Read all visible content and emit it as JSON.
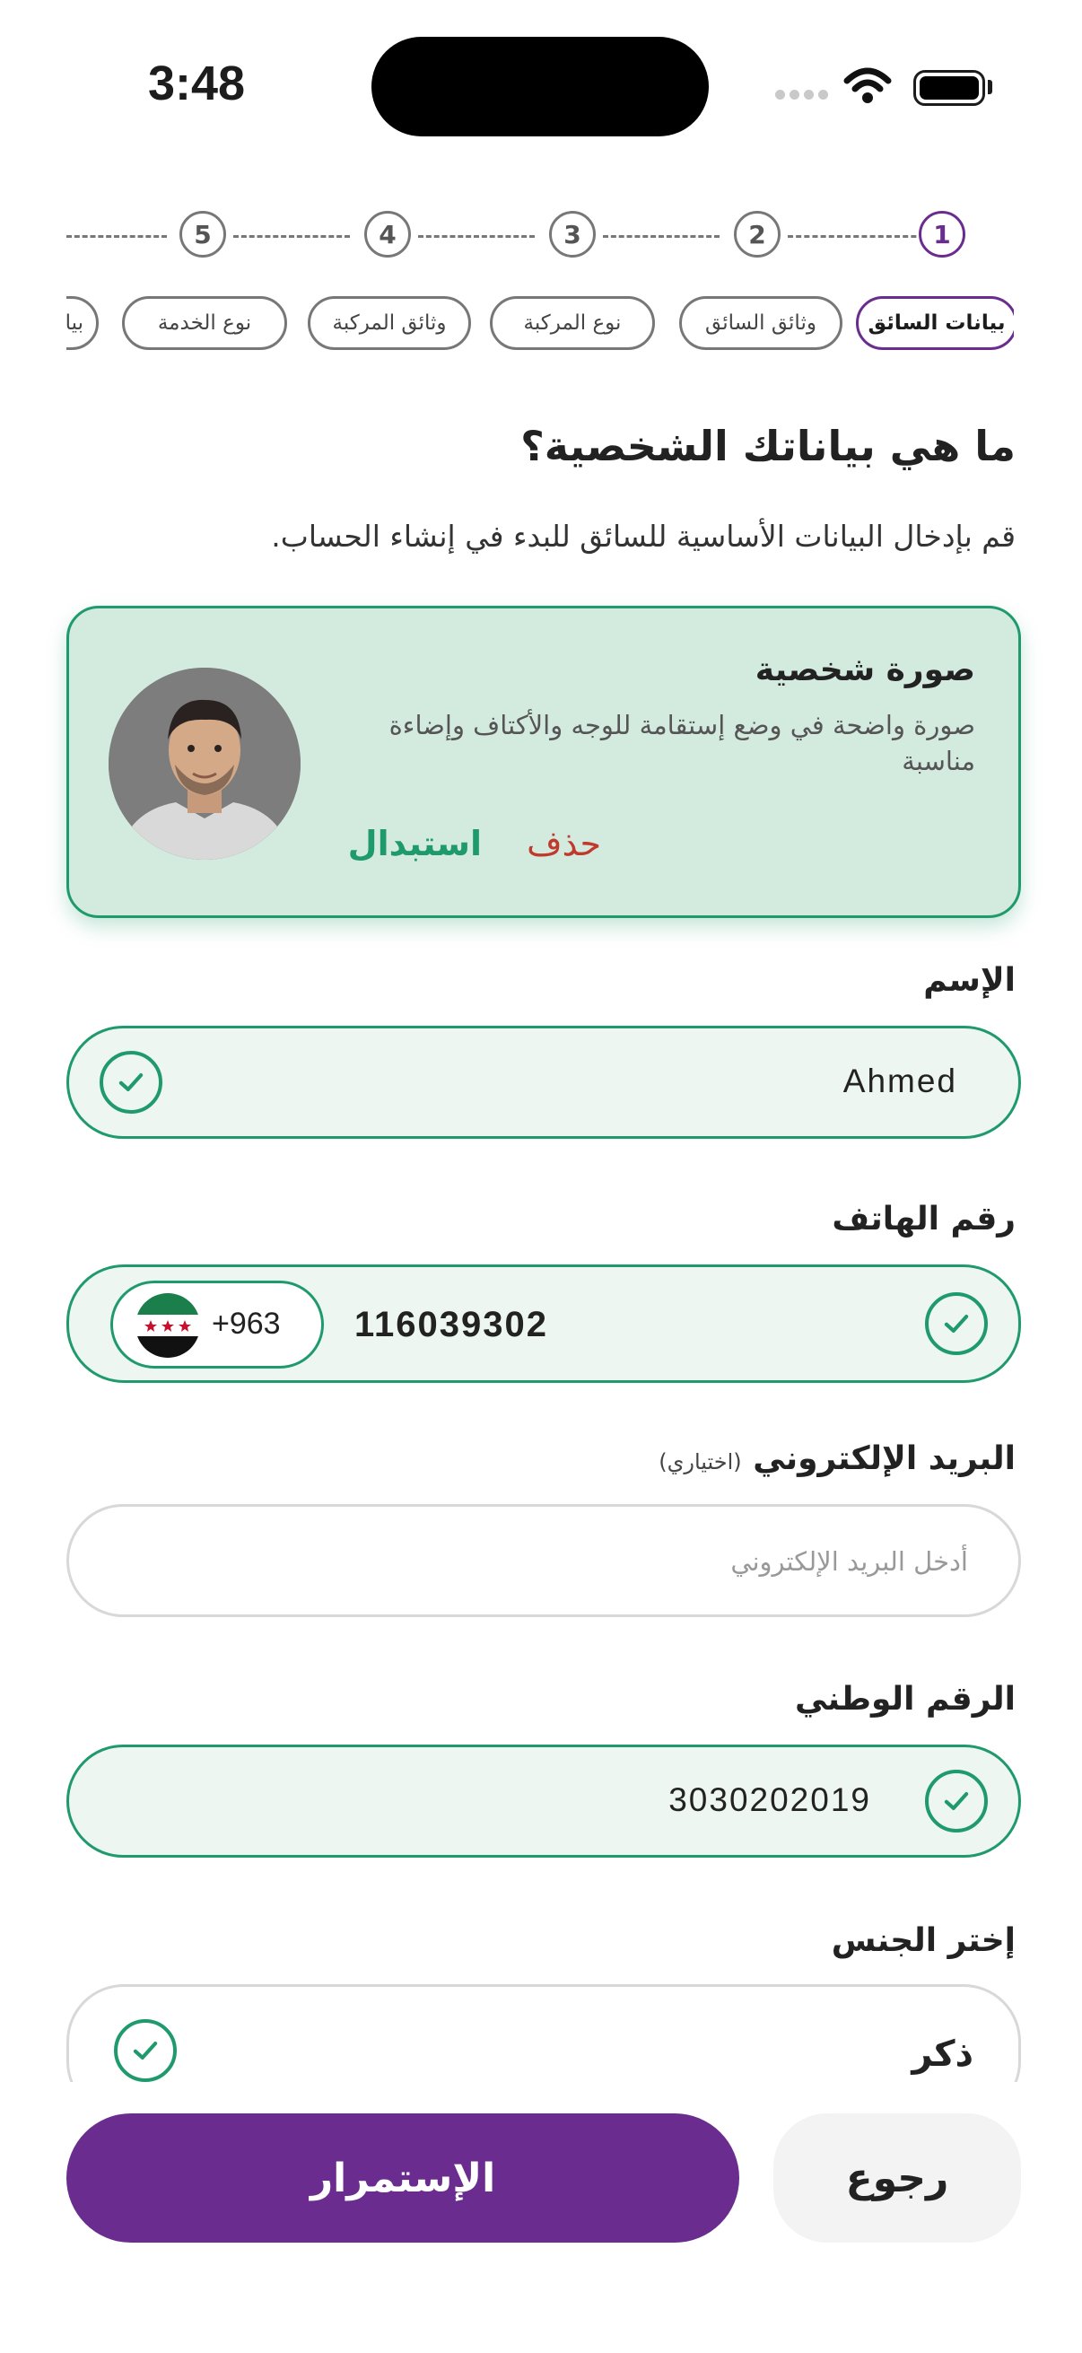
{
  "status_bar": {
    "time": "3:48"
  },
  "stepper": {
    "steps": [
      "1",
      "2",
      "3",
      "4",
      "5"
    ],
    "active_index": 0,
    "tabs": [
      "بيانات السائق",
      "وثائق السائق",
      "نوع المركبة",
      "وثائق المركبة",
      "نوع الخدمة",
      "بيا"
    ]
  },
  "page": {
    "title": "ما هي بياناتك الشخصية؟",
    "subtitle": "قم بإدخال البيانات الأساسية للسائق للبدء في إنشاء الحساب."
  },
  "photo_card": {
    "title": "صورة شخصية",
    "description": "صورة واضحة في وضع إستقامة للوجه والأكتاف وإضاءة مناسبة",
    "delete_label": "حذف",
    "replace_label": "استبدال"
  },
  "form": {
    "name": {
      "label": "الإسم",
      "value": "Ahmed"
    },
    "phone": {
      "label": "رقم الهاتف",
      "country_code": "+963",
      "value": "116039302"
    },
    "email": {
      "label": "البريد الإلكتروني",
      "optional": "(اختياري)",
      "placeholder": "أدخل البريد الإلكتروني",
      "value": ""
    },
    "national_id": {
      "label": "الرقم الوطني",
      "value": "3030202019"
    },
    "gender": {
      "label": "إختر الجنس",
      "selected": "ذكر"
    }
  },
  "buttons": {
    "next": "الإستمرار",
    "back": "رجوع"
  },
  "colors": {
    "primary": "#6a2d8f",
    "success": "#1f9a6d",
    "success_bg": "#eef6f1",
    "danger": "#c0392b"
  }
}
